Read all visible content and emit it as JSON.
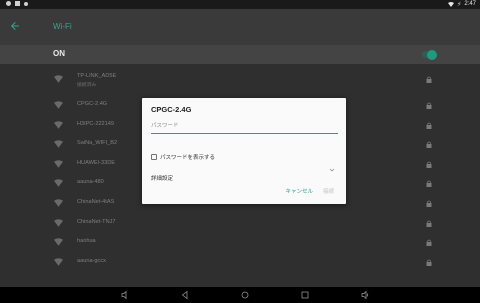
{
  "status_bar": {
    "time": "2:47",
    "battery_label": "⚡"
  },
  "app_bar": {
    "title": "Wi-Fi"
  },
  "wifi_toggle": {
    "label": "ON",
    "enabled": true
  },
  "networks": [
    {
      "ssid": "TP-LINK_AD5E",
      "status": "接続済み",
      "secured": true
    },
    {
      "ssid": "CPGC-2.4G",
      "secured": true
    },
    {
      "ssid": "H3IPC-222149",
      "secured": true
    },
    {
      "ssid": "SaiNa_WIFI_B2",
      "secured": true
    },
    {
      "ssid": "HUAWEI-33DE",
      "secured": true
    },
    {
      "ssid": "aauna-480",
      "secured": true
    },
    {
      "ssid": "ChinaNet-4tAS",
      "secured": true
    },
    {
      "ssid": "ChinaNet-TNJ7",
      "secured": true
    },
    {
      "ssid": "haohua",
      "secured": true
    },
    {
      "ssid": "aauna-gccx",
      "secured": true
    }
  ],
  "dialog": {
    "title": "CPGC-2.4G",
    "password_placeholder": "パスワード",
    "password_value": "",
    "show_password_label": "パスワードを表示する",
    "show_password_checked": false,
    "advanced_label": "詳細設定",
    "cancel_label": "キャンセル",
    "connect_label": "接続"
  },
  "colors": {
    "accent": "#2b9f88",
    "background": "#2f2f2f",
    "dialog": "#fafafa"
  },
  "icons": [
    "settings-icon",
    "notification-icon",
    "wifi-icon",
    "lock-icon",
    "back-arrow-icon",
    "chevron-down-icon",
    "volume-icon",
    "back-nav-icon",
    "home-nav-icon",
    "recents-nav-icon",
    "screenshot-icon"
  ]
}
